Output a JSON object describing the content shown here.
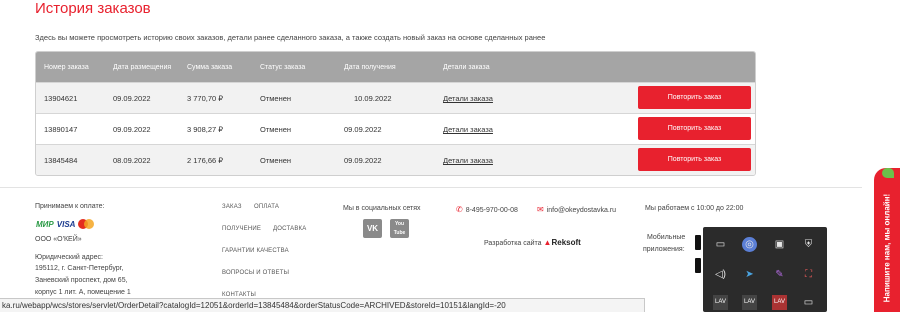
{
  "page": {
    "title": "История заказов",
    "intro": "Здесь вы можете просмотреть историю своих заказов, детали ранее сделанного заказа, а также создать новый заказ на основе сделанных ранее"
  },
  "orders": {
    "headers": {
      "number": "Номер заказа",
      "placed": "Дата размещения",
      "amount": "Сумма заказа",
      "status": "Статус заказа",
      "received": "Дата получения",
      "details": "Детали заказа"
    },
    "rows": [
      {
        "number": "13904621",
        "placed": "09.09.2022",
        "amount": "3 770,70 ₽",
        "status": "Отменен",
        "received": "10.09.2022",
        "details_link": "Детали заказа",
        "repeat_label": "Повторить заказ"
      },
      {
        "number": "13890147",
        "placed": "09.09.2022",
        "amount": "3 908,27 ₽",
        "status": "Отменен",
        "received": "09.09.2022",
        "details_link": "Детали заказа",
        "repeat_label": "Повторить заказ"
      },
      {
        "number": "13845484",
        "placed": "08.09.2022",
        "amount": "2 176,66 ₽",
        "status": "Отменен",
        "received": "09.09.2022",
        "details_link": "Детали заказа",
        "repeat_label": "Повторить заказ"
      }
    ]
  },
  "footer": {
    "payment_heading": "Принимаем к оплате:",
    "payment_logos": {
      "mir": "МИР",
      "visa": "VISA"
    },
    "company": "ООО «О'КЕЙ»",
    "legal_heading": "Юридический адрес:",
    "address_lines": [
      "195112, г. Санкт-Петербург,",
      "Заневский проспект, дом 65,",
      "корпус 1 лит. А, помещение 1"
    ],
    "nav": {
      "order": "Заказ",
      "payment": "Оплата",
      "receiving": "Получение",
      "delivery": "Доставка",
      "warranty": "Гарантии качества",
      "faq": "Вопросы и ответы",
      "contacts": "Контакты"
    },
    "social_heading": "Мы в социальных сетях",
    "social": {
      "vk": "VK",
      "youtube": "You Tube"
    },
    "phone": "8-495-970-00-08",
    "email": "info@okeydostavka.ru",
    "hours": "Мы работаем с 10:00 до 22:00",
    "developer_label": "Разработка сайта",
    "developer_name": "Reksoft",
    "mobile_apps_line1": "Мобильные",
    "mobile_apps_line2": "приложения:"
  },
  "status_bar": {
    "url": "ka.ru/webapp/wcs/stores/servlet/OrderDetail?catalogId=12051&orderId=13845484&orderStatusCode=ARCHIVED&storeId=10151&langId=-20"
  },
  "chat_tab": {
    "label": "Напишите нам, мы онлайн!"
  },
  "tray": {
    "icons": [
      "battery-icon",
      "network-globe-icon",
      "screen-icon",
      "shield-icon",
      "volume-icon",
      "telegram-icon",
      "feather-icon",
      "screenshot-icon",
      "lav-icon",
      "lav-icon",
      "lav-icon",
      "display-icon"
    ],
    "lav_label": "LAV"
  },
  "colors": {
    "accent": "#e8212e",
    "table_header": "#a5a5a5",
    "tray_bg": "#2b2b2b"
  }
}
